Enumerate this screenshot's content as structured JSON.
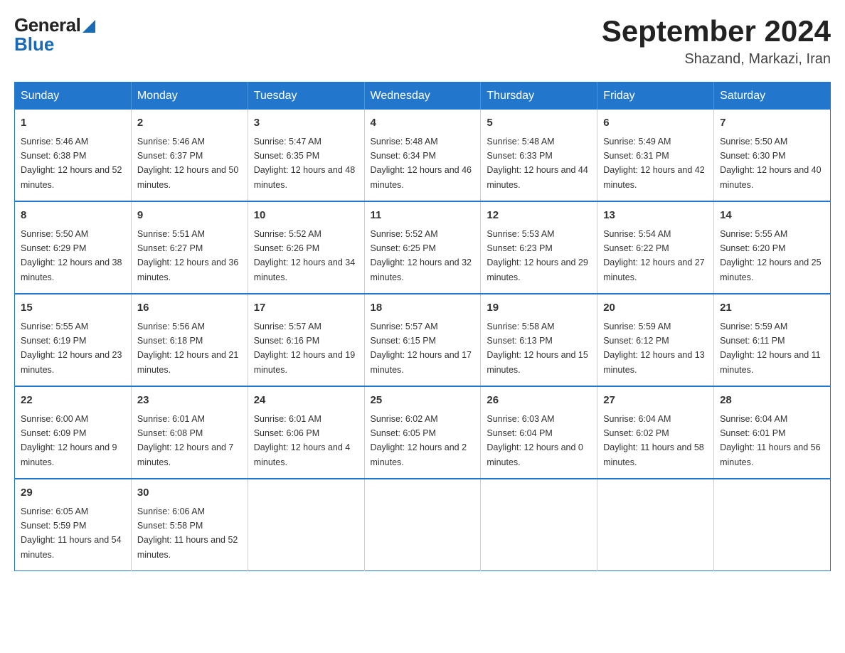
{
  "header": {
    "logo_line1": "General",
    "logo_line2": "Blue",
    "title": "September 2024",
    "location": "Shazand, Markazi, Iran"
  },
  "calendar": {
    "days_of_week": [
      "Sunday",
      "Monday",
      "Tuesday",
      "Wednesday",
      "Thursday",
      "Friday",
      "Saturday"
    ],
    "weeks": [
      [
        {
          "day": "1",
          "sunrise": "5:46 AM",
          "sunset": "6:38 PM",
          "daylight": "12 hours and 52 minutes."
        },
        {
          "day": "2",
          "sunrise": "5:46 AM",
          "sunset": "6:37 PM",
          "daylight": "12 hours and 50 minutes."
        },
        {
          "day": "3",
          "sunrise": "5:47 AM",
          "sunset": "6:35 PM",
          "daylight": "12 hours and 48 minutes."
        },
        {
          "day": "4",
          "sunrise": "5:48 AM",
          "sunset": "6:34 PM",
          "daylight": "12 hours and 46 minutes."
        },
        {
          "day": "5",
          "sunrise": "5:48 AM",
          "sunset": "6:33 PM",
          "daylight": "12 hours and 44 minutes."
        },
        {
          "day": "6",
          "sunrise": "5:49 AM",
          "sunset": "6:31 PM",
          "daylight": "12 hours and 42 minutes."
        },
        {
          "day": "7",
          "sunrise": "5:50 AM",
          "sunset": "6:30 PM",
          "daylight": "12 hours and 40 minutes."
        }
      ],
      [
        {
          "day": "8",
          "sunrise": "5:50 AM",
          "sunset": "6:29 PM",
          "daylight": "12 hours and 38 minutes."
        },
        {
          "day": "9",
          "sunrise": "5:51 AM",
          "sunset": "6:27 PM",
          "daylight": "12 hours and 36 minutes."
        },
        {
          "day": "10",
          "sunrise": "5:52 AM",
          "sunset": "6:26 PM",
          "daylight": "12 hours and 34 minutes."
        },
        {
          "day": "11",
          "sunrise": "5:52 AM",
          "sunset": "6:25 PM",
          "daylight": "12 hours and 32 minutes."
        },
        {
          "day": "12",
          "sunrise": "5:53 AM",
          "sunset": "6:23 PM",
          "daylight": "12 hours and 29 minutes."
        },
        {
          "day": "13",
          "sunrise": "5:54 AM",
          "sunset": "6:22 PM",
          "daylight": "12 hours and 27 minutes."
        },
        {
          "day": "14",
          "sunrise": "5:55 AM",
          "sunset": "6:20 PM",
          "daylight": "12 hours and 25 minutes."
        }
      ],
      [
        {
          "day": "15",
          "sunrise": "5:55 AM",
          "sunset": "6:19 PM",
          "daylight": "12 hours and 23 minutes."
        },
        {
          "day": "16",
          "sunrise": "5:56 AM",
          "sunset": "6:18 PM",
          "daylight": "12 hours and 21 minutes."
        },
        {
          "day": "17",
          "sunrise": "5:57 AM",
          "sunset": "6:16 PM",
          "daylight": "12 hours and 19 minutes."
        },
        {
          "day": "18",
          "sunrise": "5:57 AM",
          "sunset": "6:15 PM",
          "daylight": "12 hours and 17 minutes."
        },
        {
          "day": "19",
          "sunrise": "5:58 AM",
          "sunset": "6:13 PM",
          "daylight": "12 hours and 15 minutes."
        },
        {
          "day": "20",
          "sunrise": "5:59 AM",
          "sunset": "6:12 PM",
          "daylight": "12 hours and 13 minutes."
        },
        {
          "day": "21",
          "sunrise": "5:59 AM",
          "sunset": "6:11 PM",
          "daylight": "12 hours and 11 minutes."
        }
      ],
      [
        {
          "day": "22",
          "sunrise": "6:00 AM",
          "sunset": "6:09 PM",
          "daylight": "12 hours and 9 minutes."
        },
        {
          "day": "23",
          "sunrise": "6:01 AM",
          "sunset": "6:08 PM",
          "daylight": "12 hours and 7 minutes."
        },
        {
          "day": "24",
          "sunrise": "6:01 AM",
          "sunset": "6:06 PM",
          "daylight": "12 hours and 4 minutes."
        },
        {
          "day": "25",
          "sunrise": "6:02 AM",
          "sunset": "6:05 PM",
          "daylight": "12 hours and 2 minutes."
        },
        {
          "day": "26",
          "sunrise": "6:03 AM",
          "sunset": "6:04 PM",
          "daylight": "12 hours and 0 minutes."
        },
        {
          "day": "27",
          "sunrise": "6:04 AM",
          "sunset": "6:02 PM",
          "daylight": "11 hours and 58 minutes."
        },
        {
          "day": "28",
          "sunrise": "6:04 AM",
          "sunset": "6:01 PM",
          "daylight": "11 hours and 56 minutes."
        }
      ],
      [
        {
          "day": "29",
          "sunrise": "6:05 AM",
          "sunset": "5:59 PM",
          "daylight": "11 hours and 54 minutes."
        },
        {
          "day": "30",
          "sunrise": "6:06 AM",
          "sunset": "5:58 PM",
          "daylight": "11 hours and 52 minutes."
        },
        null,
        null,
        null,
        null,
        null
      ]
    ]
  }
}
